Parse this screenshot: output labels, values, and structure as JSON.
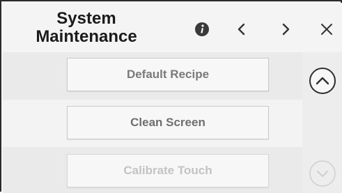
{
  "header": {
    "title_line1": "System",
    "title_line2": "Maintenance",
    "icons": {
      "info": "info-icon",
      "prev": "chevron-left-icon",
      "next": "chevron-right-icon",
      "close": "close-icon"
    }
  },
  "buttons": {
    "default_recipe": "Default Recipe",
    "clean_screen": "Clean Screen",
    "calibrate_touch": "Calibrate Touch"
  },
  "scroll": {
    "up_icon": "chevron-up-circle-icon",
    "down_icon": "chevron-down-circle-icon"
  },
  "colors": {
    "text": "#1b1b1b",
    "button_text": "#7a7a7a",
    "disabled_text": "#c3c3c3",
    "background": "#f4f4f4"
  }
}
